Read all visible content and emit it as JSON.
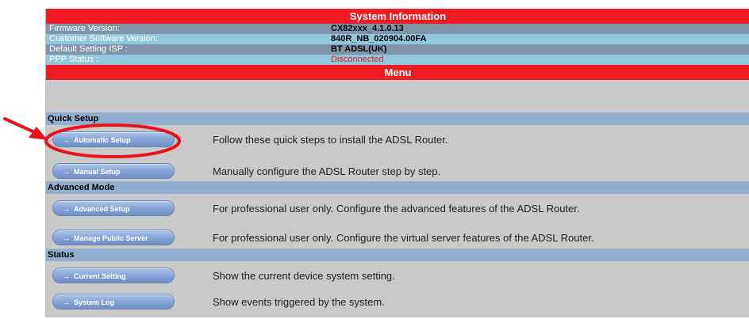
{
  "system_info": {
    "title": "System Information",
    "rows": [
      {
        "label": "Firmware Version:",
        "value": "CX82xxx_4.1.0.13"
      },
      {
        "label": "Customer Software Version:",
        "value": "840R_NB_020904.00FA"
      },
      {
        "label": "Default Setting ISP :",
        "value": "BT ADSL(UK)"
      },
      {
        "label": "PPP Status :",
        "value": "Disconnected"
      }
    ]
  },
  "menu": {
    "title": "Menu",
    "sections": [
      {
        "title": "Quick Setup",
        "items": [
          {
            "button": "Automatic Setup",
            "description": "Follow these quick steps to install the ADSL Router."
          },
          {
            "button": "Manual Setup",
            "description": "Manually configure the ADSL Router step by step."
          }
        ]
      },
      {
        "title": "Advanced Mode",
        "items": [
          {
            "button": "Advanced Setup",
            "description": "For professional user only. Configure the advanced features of the ADSL Router."
          },
          {
            "button": "Manage Public Server",
            "description": "For professional user only. Configure the virtual server features of the ADSL Router."
          }
        ]
      },
      {
        "title": "Status",
        "items": [
          {
            "button": "Current Setting",
            "description": "Show the current device system setting."
          },
          {
            "button": "System Log",
            "description": "Show events triggered by the system."
          }
        ]
      }
    ]
  },
  "button_arrow": "→",
  "colors": {
    "header_red": "#ee1c22",
    "row_dark": "#7f93a9",
    "row_light": "#91c8e0",
    "section_blue": "#90aed0",
    "panel_grey": "#c9c9c9",
    "status_red": "#d9211c",
    "annotation_red": "#e8141b"
  }
}
